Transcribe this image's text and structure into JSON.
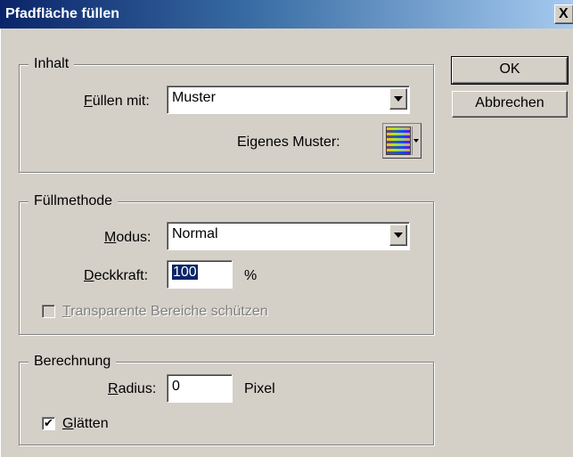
{
  "window": {
    "title": "Pfadfläche füllen",
    "close_glyph": "X"
  },
  "inhalt": {
    "legend": "Inhalt",
    "fill_with": {
      "hotkey": "F",
      "label_rest": "üllen mit:",
      "value": "Muster"
    },
    "custom_pattern": {
      "label": "Eigenes Muster:",
      "icon": "pattern-swatch-icon"
    }
  },
  "fuellmethode": {
    "legend": "Füllmethode",
    "mode": {
      "hotkey": "M",
      "label_rest": "odus:",
      "value": "Normal"
    },
    "opacity": {
      "hotkey": "D",
      "label_rest": "eckkraft:",
      "value": "100",
      "unit": "%"
    },
    "preserve_transparency": {
      "hotkey": "T",
      "label_rest": "ransparente Bereiche schützen",
      "checked": false,
      "disabled": true
    }
  },
  "berechnung": {
    "legend": "Berechnung",
    "radius": {
      "hotkey": "R",
      "label_rest": "adius:",
      "value": "0",
      "unit": "Pixel"
    },
    "antialias": {
      "hotkey": "G",
      "label_rest": "lätten",
      "checked": true,
      "check_glyph": "✔"
    }
  },
  "buttons": {
    "ok": "OK",
    "cancel": "Abbrechen"
  },
  "colors": {
    "dialog_bg": "#d4d0c8",
    "title_start": "#0a246a",
    "title_end": "#a6caf0",
    "selection": "#0a246a"
  }
}
